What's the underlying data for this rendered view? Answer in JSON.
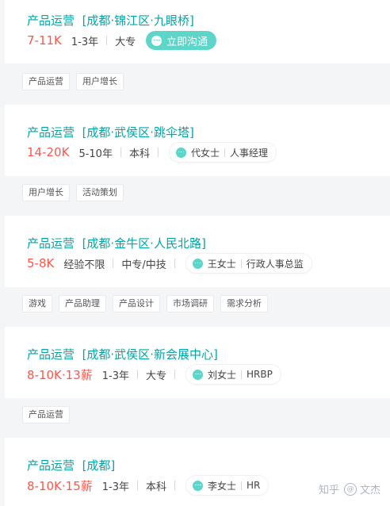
{
  "jobs": [
    {
      "title": "产品运营",
      "location": "[成都·锦江区·九眼桥]",
      "salary": "7-11K",
      "experience": "1-3年",
      "education": "大专",
      "action_label": "立即沟通",
      "tags": [
        "产品运营",
        "用户增长"
      ]
    },
    {
      "title": "产品运营",
      "location": "[成都·武侯区·跳伞塔]",
      "salary": "14-20K",
      "experience": "5-10年",
      "education": "本科",
      "recruiter_name": "代女士",
      "recruiter_role": "人事经理",
      "tags": [
        "用户增长",
        "活动策划"
      ]
    },
    {
      "title": "产品运营",
      "location": "[成都·金牛区·人民北路]",
      "salary": "5-8K",
      "experience": "经验不限",
      "education": "中专/中技",
      "recruiter_name": "王女士",
      "recruiter_role": "行政人事总监",
      "tags": [
        "游戏",
        "产品助理",
        "产品设计",
        "市场调研",
        "需求分析"
      ]
    },
    {
      "title": "产品运营",
      "location": "[成都·武侯区·新会展中心]",
      "salary": "8-10K·13薪",
      "experience": "1-3年",
      "education": "大专",
      "recruiter_name": "刘女士",
      "recruiter_role": "HRBP",
      "tags": [
        "产品运营"
      ]
    },
    {
      "title": "产品运营",
      "location": "[成都]",
      "salary": "8-10K·15薪",
      "experience": "1-3年",
      "education": "本科",
      "recruiter_name": "李女士",
      "recruiter_role": "HR",
      "tags": []
    }
  ],
  "watermark": {
    "platform": "知乎",
    "author": "文杰"
  },
  "colors": {
    "title": "#00a6a7",
    "salary": "#fe574a",
    "chat_button": "#5dd5c8",
    "background": "#f4f5f7"
  }
}
